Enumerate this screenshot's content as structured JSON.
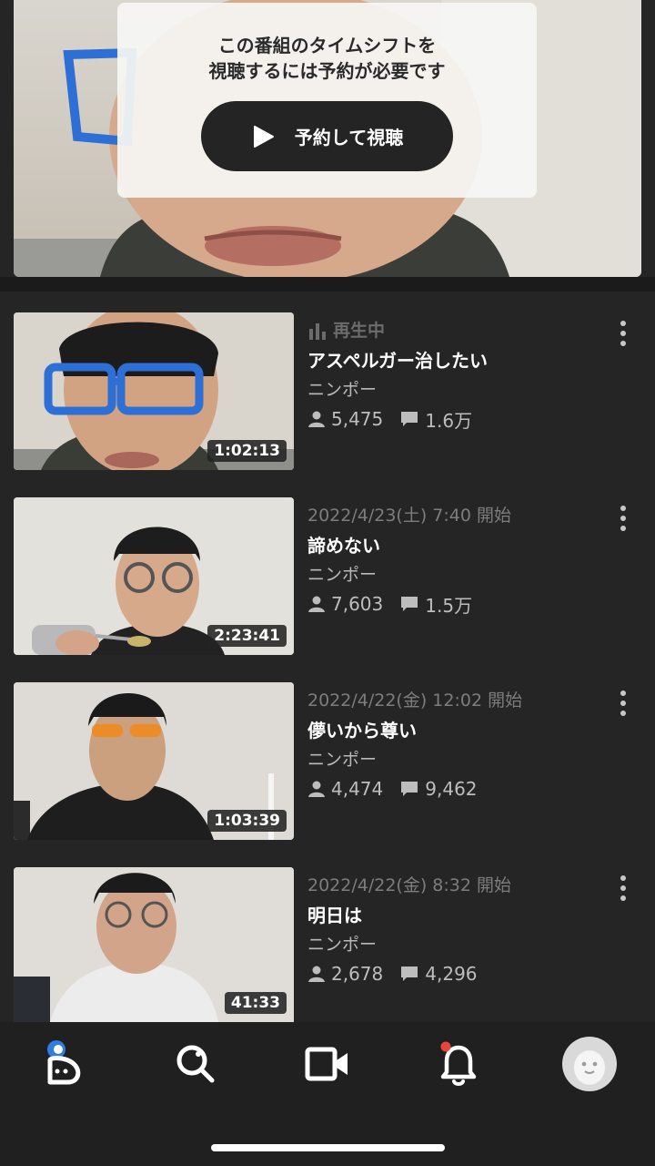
{
  "player": {
    "overlay_message": "この番組のタイムシフトを\n視聴するには予約が必要です",
    "reserve_button_label": "予約して視聴"
  },
  "programs": [
    {
      "status": "再生中",
      "status_type": "playing",
      "title": "アスペルガー治したい",
      "channel": "ニンポー",
      "viewers": "5,475",
      "comments": "1.6万",
      "duration": "1:02:13"
    },
    {
      "status": "2022/4/23(土) 7:40 開始",
      "status_type": "scheduled",
      "title": "諦めない",
      "channel": "ニンポー",
      "viewers": "7,603",
      "comments": "1.5万",
      "duration": "2:23:41"
    },
    {
      "status": "2022/4/22(金) 12:02 開始",
      "status_type": "scheduled",
      "title": "儚いから尊い",
      "channel": "ニンポー",
      "viewers": "4,474",
      "comments": "9,462",
      "duration": "1:03:39"
    },
    {
      "status": "2022/4/22(金) 8:32 開始",
      "status_type": "scheduled",
      "title": "明日は",
      "channel": "ニンポー",
      "viewers": "2,678",
      "comments": "4,296",
      "duration": "41:33"
    }
  ],
  "bottom_nav": {
    "items": [
      "home-icon",
      "search-icon",
      "video-camera-icon",
      "bell-icon",
      "profile-avatar"
    ],
    "notification_dot_color": "#e8463c"
  },
  "colors": {
    "background": "#252525",
    "nav_background": "#202020",
    "avatar_bg": "#d9d9d9",
    "glasses_blue": "#2e6fd6",
    "glasses_orange": "#f08a1e"
  }
}
